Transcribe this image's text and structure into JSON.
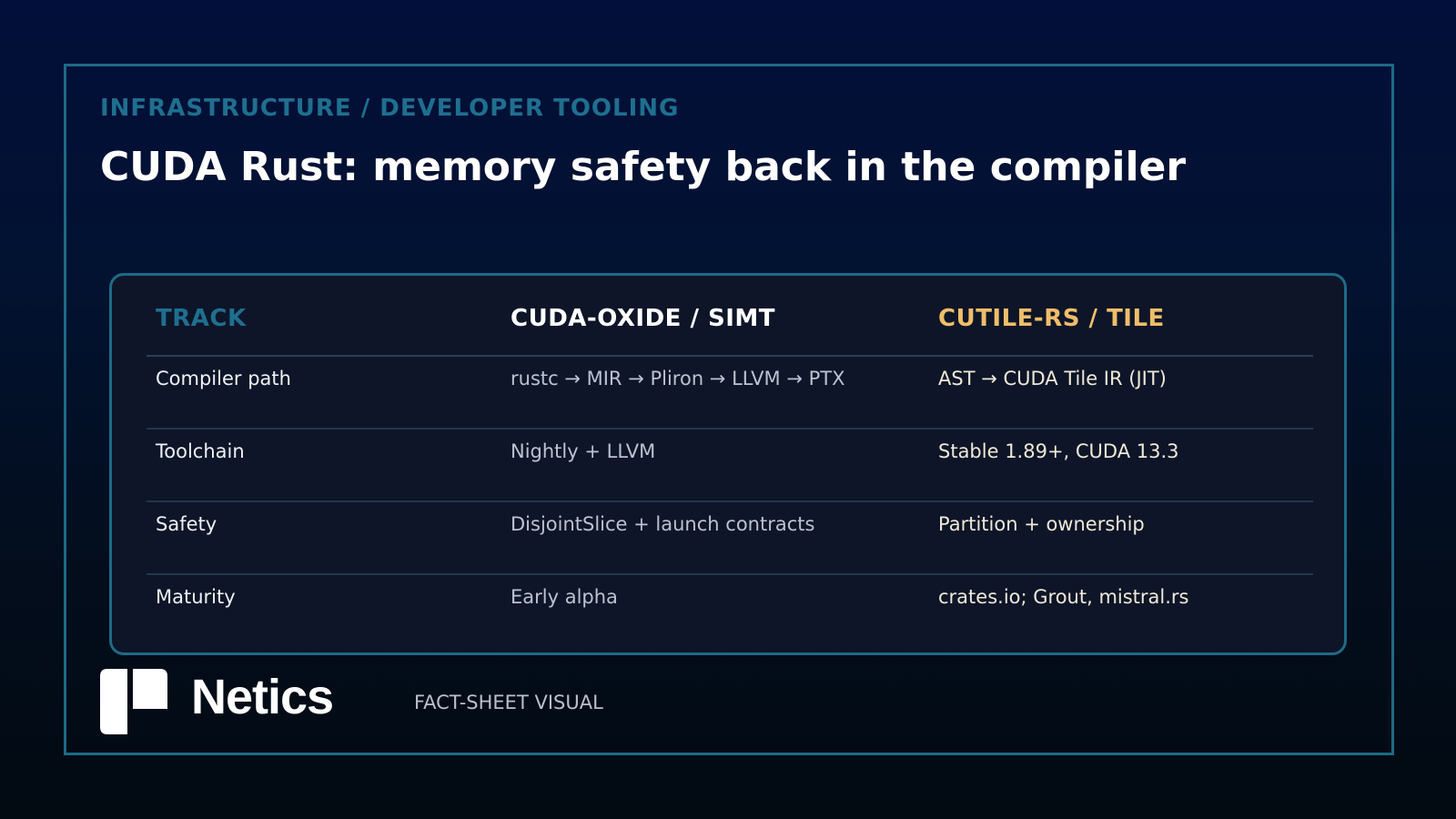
{
  "header": {
    "kicker": "INFRASTRUCTURE / DEVELOPER TOOLING",
    "title": "CUDA Rust: memory safety back in the compiler"
  },
  "table": {
    "columns": [
      "TRACK",
      "CUDA-OXIDE / SIMT",
      "CUTILE-RS / TILE"
    ],
    "rows": [
      [
        "Compiler path",
        "rustc → MIR → Pliron → LLVM → PTX",
        "AST → CUDA Tile IR (JIT)"
      ],
      [
        "Toolchain",
        "Nightly + LLVM",
        "Stable 1.89+, CUDA 13.3"
      ],
      [
        "Safety",
        "DisjointSlice + launch contracts",
        "Partition + ownership"
      ],
      [
        "Maturity",
        "Early alpha",
        "crates.io; Grout, mistral.rs"
      ]
    ]
  },
  "footer": {
    "brand": "Netics",
    "tag": "FACT-SHEET VISUAL",
    "logo_icon": "netics-logo-icon"
  },
  "colors": {
    "accent_teal": "#1f6f8f",
    "accent_gold": "#efbe6a",
    "border": "#1d6b86",
    "panel_bg": "#0e1528"
  }
}
